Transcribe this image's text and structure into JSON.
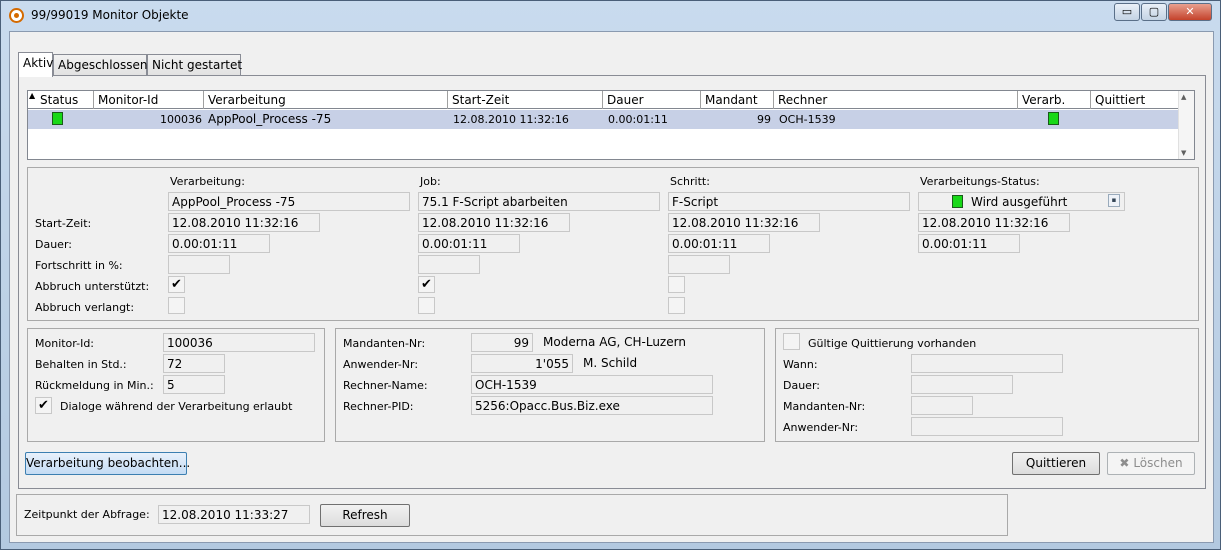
{
  "window": {
    "title": "99/99019 Monitor Objekte",
    "min_glyph": "▭",
    "max_glyph": "▢",
    "close_glyph": "✕"
  },
  "tabs": [
    "Aktiv",
    "Abgeschlossen",
    "Nicht gestartet"
  ],
  "grid": {
    "sort_glyph": "▲",
    "headers": [
      "Status",
      "Monitor-Id",
      "Verarbeitung",
      "Start-Zeit",
      "Dauer",
      "Mandant",
      "Rechner",
      "Verarb.",
      "Quittiert"
    ],
    "row": {
      "monitor_id": "100036",
      "verarbeitung": "AppPool_Process -75",
      "start_zeit": "12.08.2010 11:32:16",
      "dauer": "0.00:01:11",
      "mandant": "99",
      "rechner": "OCH-1539"
    },
    "scroll_up": "▲",
    "scroll_down": "▼"
  },
  "details": {
    "row_labels": {
      "start_zeit": "Start-Zeit:",
      "dauer": "Dauer:",
      "fortschritt": "Fortschritt in %:",
      "abbruch_unterstuetzt": "Abbruch unterstützt:",
      "abbruch_verlangt": "Abbruch verlangt:"
    },
    "verarbeitung": {
      "header": "Verarbeitung:",
      "value": "AppPool_Process -75",
      "start": "12.08.2010 11:32:16",
      "dauer": "0.00:01:11",
      "fortschritt": "",
      "abbruch_unterstuetzt": "✔",
      "abbruch_verlangt": ""
    },
    "job": {
      "header": "Job:",
      "value": "75.1 F-Script abarbeiten",
      "start": "12.08.2010 11:32:16",
      "dauer": "0.00:01:11",
      "fortschritt": "",
      "abbruch_unterstuetzt": "✔",
      "abbruch_verlangt": ""
    },
    "schritt": {
      "header": "Schritt:",
      "value": "F-Script",
      "start": "12.08.2010 11:32:16",
      "dauer": "0.00:01:11",
      "fortschritt": ""
    },
    "status": {
      "header": "Verarbeitungs-Status:",
      "value": "Wird ausgeführt",
      "start": "12.08.2010 11:32:16",
      "dauer": "0.00:01:11",
      "dropdown_glyph": "▪"
    }
  },
  "monitor": {
    "id_label": "Monitor-Id:",
    "id_value": "100036",
    "behalten_label": "Behalten in Std.:",
    "behalten_value": "72",
    "rueckmeldung_label": "Rückmeldung in Min.:",
    "rueckmeldung_value": "5",
    "dialoge_label": "Dialoge während der Verarbeitung erlaubt",
    "dialoge_check": "✔"
  },
  "mandant": {
    "nr_label": "Mandanten-Nr:",
    "nr_value": "99",
    "nr_name": "Moderna AG, CH-Luzern",
    "anwender_label": "Anwender-Nr:",
    "anwender_value": "1'055",
    "anwender_name": "M. Schild",
    "rechner_label": "Rechner-Name:",
    "rechner_value": "OCH-1539",
    "pid_label": "Rechner-PID:",
    "pid_value": "5256:Opacc.Bus.Biz.exe"
  },
  "quittierung": {
    "label": "Gültige Quittierung vorhanden",
    "wann_label": "Wann:",
    "wann_value": "",
    "dauer_label": "Dauer:",
    "dauer_value": "",
    "mandant_label": "Mandanten-Nr:",
    "mandant_value": "",
    "anwender_label": "Anwender-Nr:",
    "anwender_value": ""
  },
  "buttons": {
    "beobachten": "Verarbeitung beobachten...",
    "quittieren": "Quittieren",
    "loeschen_icon": "✖",
    "loeschen": "Löschen",
    "refresh": "Refresh"
  },
  "footer": {
    "zeitpunkt_label": "Zeitpunkt der Abfrage:",
    "zeitpunkt_value": "12.08.2010 11:33:27"
  },
  "colors": {
    "accent": "#18d818",
    "selection": "#c7d0e6",
    "titlebar": "#c9dbee"
  }
}
